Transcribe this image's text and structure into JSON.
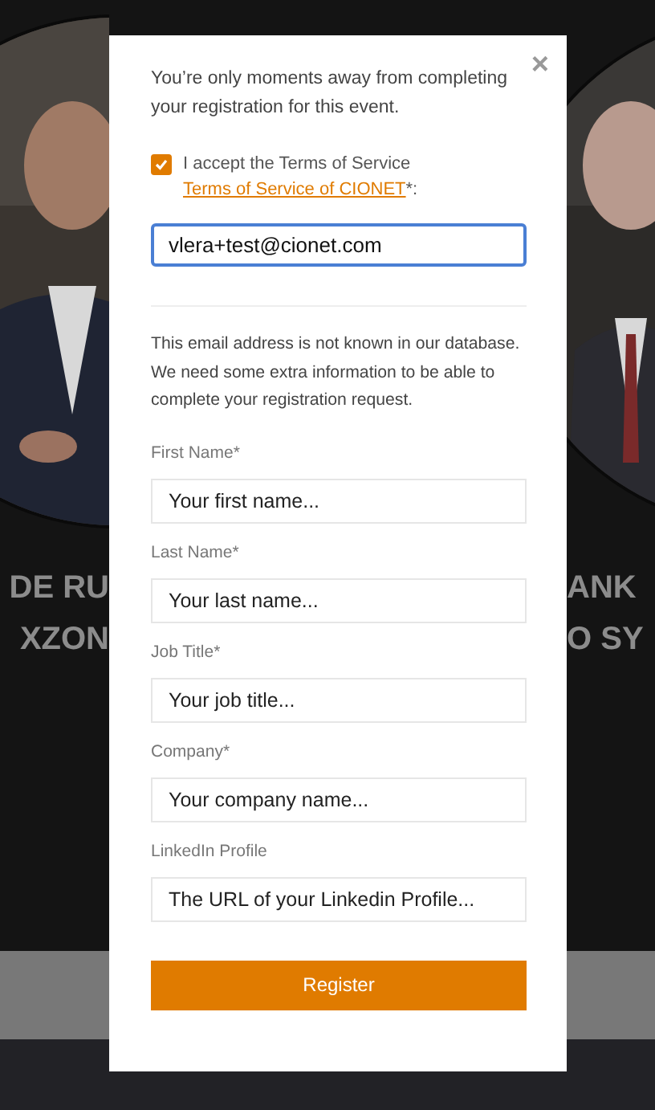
{
  "background": {
    "speakers": [
      {
        "name_lines": [
          "DE RU",
          "XZON"
        ]
      },
      {
        "name_lines": [
          "ANK",
          "O SY"
        ]
      }
    ]
  },
  "modal": {
    "close": "×",
    "intro": "You’re only moments away from completing your registration for this event.",
    "terms": {
      "checked": true,
      "text": "I accept the Terms of Service",
      "link": "Terms of Service of CIONET",
      "suffix": "*:"
    },
    "email": {
      "value": "vlera+test@cionet.com"
    },
    "notice": "This email address is not known in our database. We need some extra information to be able to complete your registration request.",
    "fields": [
      {
        "label": "First Name*",
        "placeholder": "Your first name..."
      },
      {
        "label": "Last Name*",
        "placeholder": "Your last name..."
      },
      {
        "label": "Job Title*",
        "placeholder": "Your job title..."
      },
      {
        "label": "Company*",
        "placeholder": "Your company name..."
      },
      {
        "label": "LinkedIn Profile",
        "placeholder": "The URL of your Linkedin Profile..."
      }
    ],
    "submit": "Register"
  }
}
